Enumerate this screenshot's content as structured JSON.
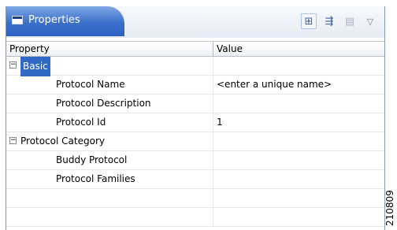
{
  "view": {
    "tab_title": "Properties",
    "tab_icon": "properties-view-icon",
    "toolbar": [
      {
        "name": "show-categories-icon",
        "glyph": "⊞",
        "state": "active"
      },
      {
        "name": "show-advanced-properties-icon",
        "glyph": "⇶",
        "state": "normal"
      },
      {
        "name": "restore-default-icon",
        "glyph": "▤",
        "state": "disabled"
      },
      {
        "name": "view-menu-icon",
        "glyph": "▽",
        "state": "normal"
      }
    ]
  },
  "table": {
    "columns": {
      "property": "Property",
      "value": "Value"
    },
    "rows": [
      {
        "type": "category",
        "expanded": true,
        "selected": true,
        "label": "Basic",
        "value": ""
      },
      {
        "type": "property",
        "label": "Protocol Name",
        "value": "<enter a unique name>"
      },
      {
        "type": "property",
        "label": "Protocol Description",
        "value": ""
      },
      {
        "type": "property",
        "label": "Protocol Id",
        "value": "1"
      },
      {
        "type": "category",
        "expanded": true,
        "selected": false,
        "label": "Protocol Category",
        "value": ""
      },
      {
        "type": "property",
        "label": "Buddy Protocol",
        "value": ""
      },
      {
        "type": "property",
        "label": "Protocol Families",
        "value": ""
      },
      {
        "type": "empty",
        "label": "",
        "value": ""
      },
      {
        "type": "empty",
        "label": "",
        "value": ""
      }
    ]
  },
  "figure_id": "210809",
  "colors": {
    "tab_blue": "#3b6fc9",
    "selection": "#3169c6"
  }
}
